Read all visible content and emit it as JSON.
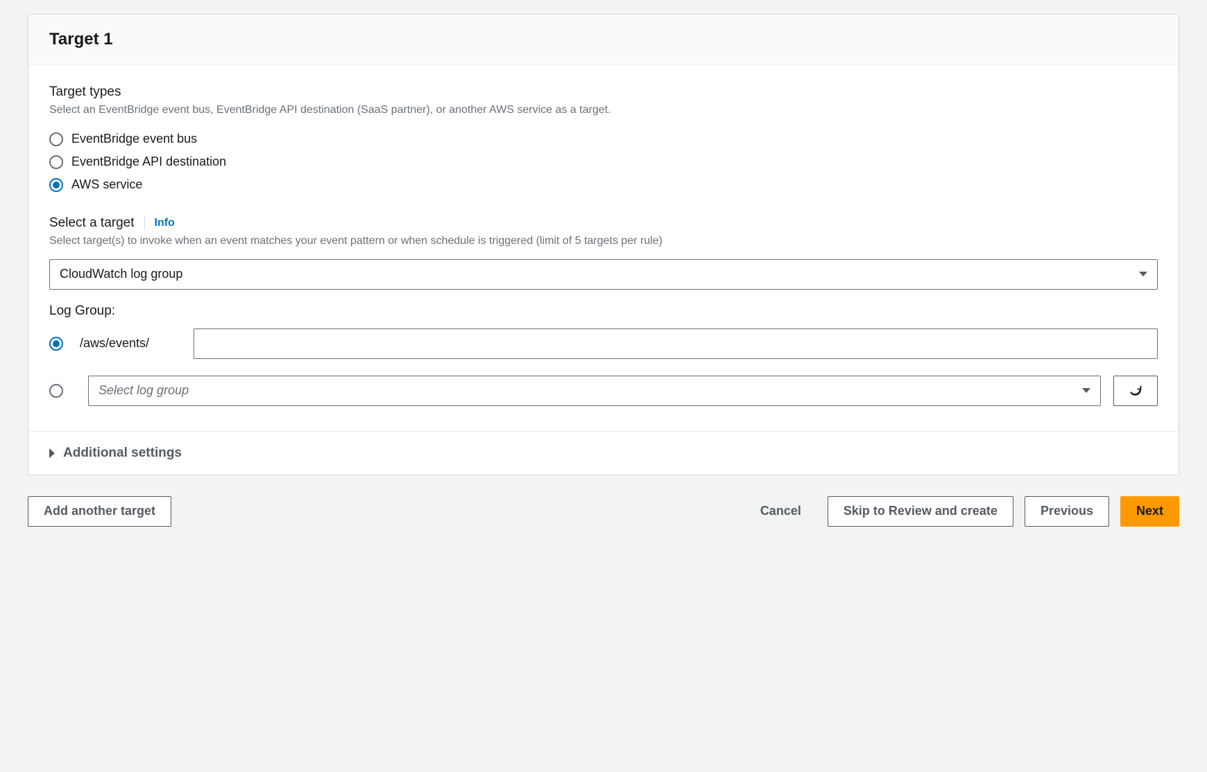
{
  "panel": {
    "title": "Target 1",
    "target_types": {
      "heading": "Target types",
      "description": "Select an EventBridge event bus, EventBridge API destination (SaaS partner), or another AWS service as a target.",
      "options": [
        {
          "label": "EventBridge event bus",
          "selected": false
        },
        {
          "label": "EventBridge API destination",
          "selected": false
        },
        {
          "label": "AWS service",
          "selected": true
        }
      ]
    },
    "select_target": {
      "heading": "Select a target",
      "info_label": "Info",
      "description": "Select target(s) to invoke when an event matches your event pattern or when schedule is triggered (limit of 5 targets per rule)",
      "selected_value": "CloudWatch log group"
    },
    "log_group": {
      "heading": "Log Group:",
      "prefix": "/aws/events/",
      "input_value": "",
      "select_placeholder": "Select log group"
    },
    "additional_settings_label": "Additional settings"
  },
  "actions": {
    "add_another": "Add another target",
    "cancel": "Cancel",
    "skip": "Skip to Review and create",
    "previous": "Previous",
    "next": "Next"
  }
}
